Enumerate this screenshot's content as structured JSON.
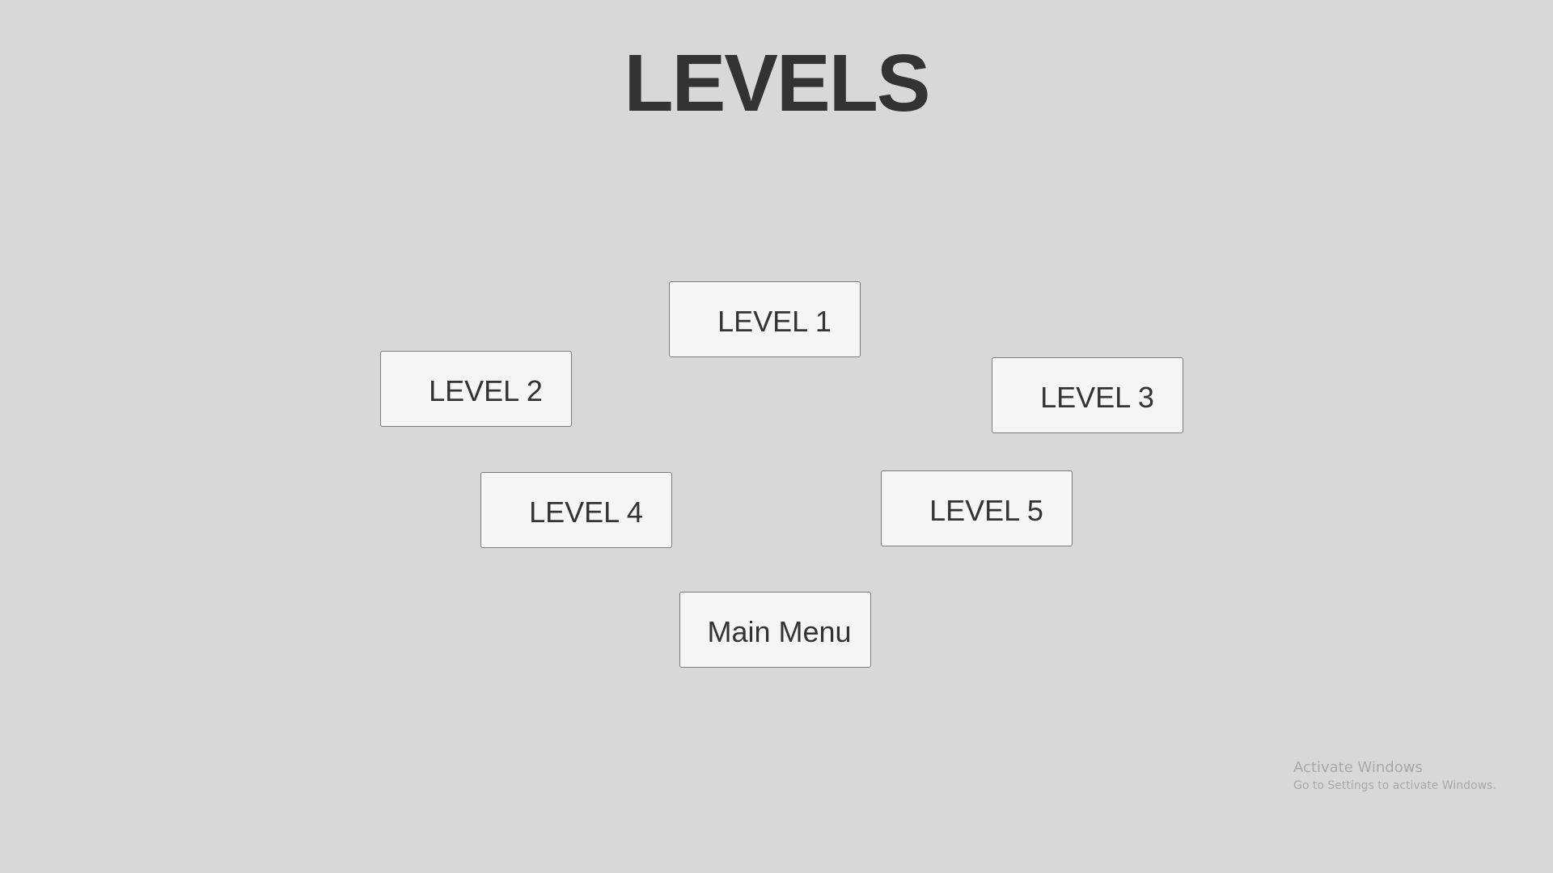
{
  "title": "LEVELS",
  "buttons": {
    "level1": "LEVEL 1",
    "level2": "LEVEL 2",
    "level3": "LEVEL 3",
    "level4": "LEVEL 4",
    "level5": "LEVEL 5",
    "main_menu": "Main Menu"
  },
  "watermark": {
    "title": "Activate Windows",
    "subtitle": "Go to Settings to activate Windows."
  },
  "colors": {
    "background": "#d8d8d8",
    "button_fill": "#f5f5f5",
    "button_border": "#7a7a7a",
    "text": "#333333",
    "watermark_text": "#a8a8a8"
  }
}
